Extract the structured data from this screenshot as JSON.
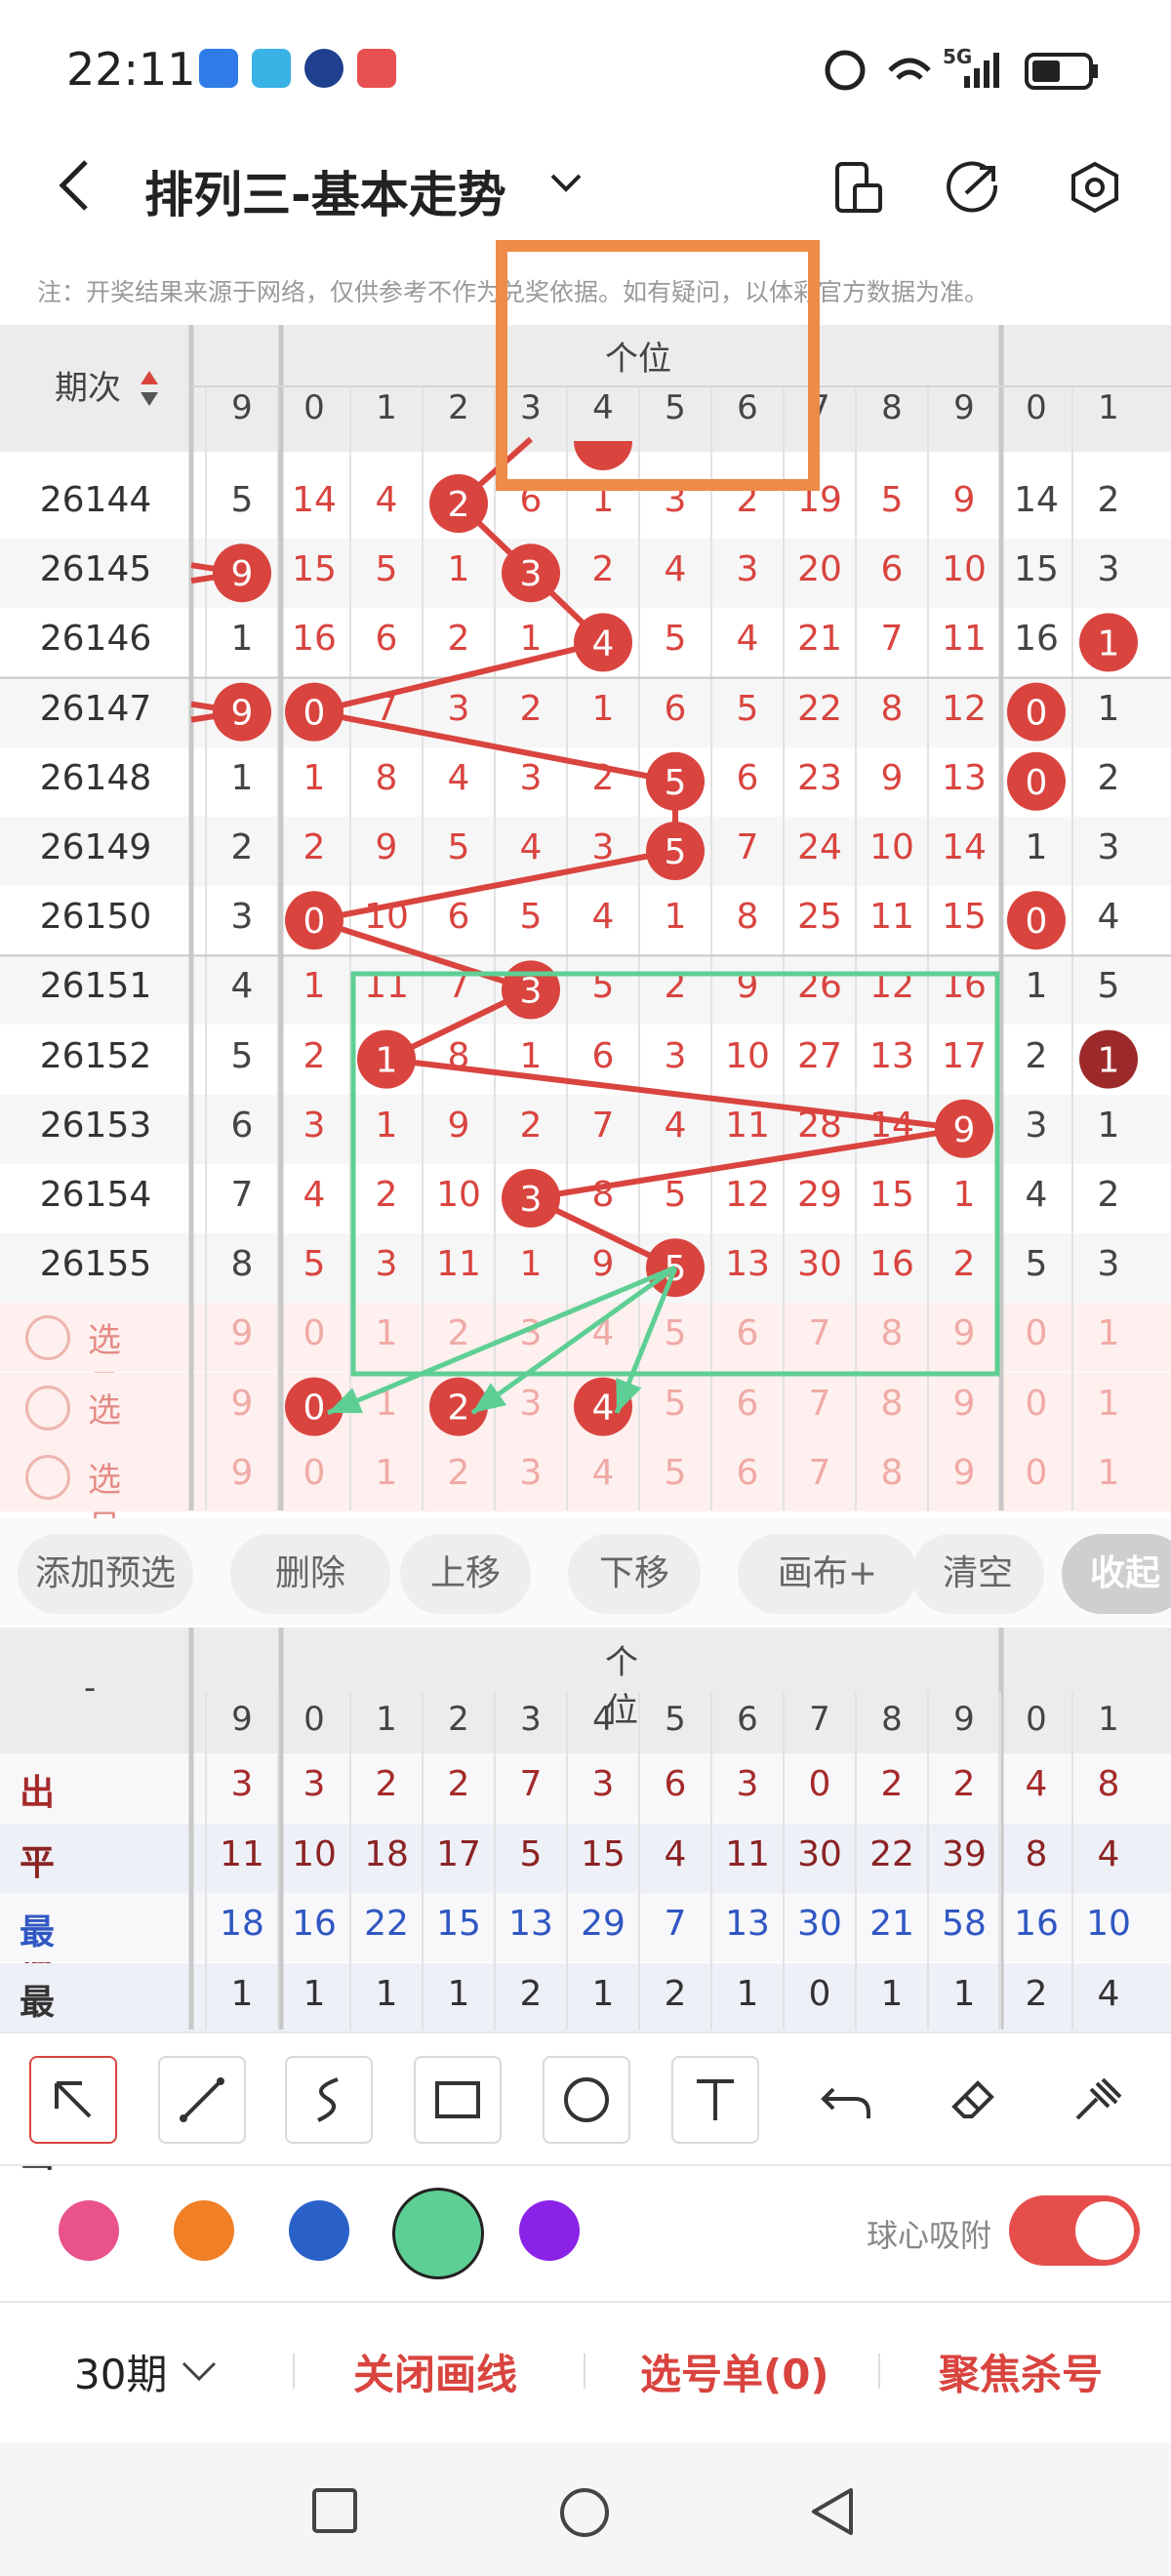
{
  "status": {
    "time": "22:11",
    "signal_label": "5G"
  },
  "header": {
    "title": "排列三-基本走势",
    "dropdown_icon": "chevron-down-icon",
    "icons": [
      "phone-icon",
      "share-icon",
      "settings-icon"
    ]
  },
  "notice": "注：开奖结果来源于网络，仅供参考不作为兑奖依据。如有疑问，以体彩官方数据为准。",
  "table": {
    "period_header": "期次",
    "group_label": "个位",
    "col_digits": [
      "9",
      "0",
      "1",
      "2",
      "3",
      "4",
      "5",
      "6",
      "7",
      "8",
      "9",
      "0",
      "1"
    ],
    "rows": [
      {
        "period": "26144",
        "cells": [
          "5",
          "14",
          "4",
          "2",
          "6",
          "1",
          "3",
          "2",
          "19",
          "5",
          "9",
          "14",
          "2"
        ]
      },
      {
        "period": "26145",
        "cells": [
          "9",
          "15",
          "5",
          "1",
          "3",
          "2",
          "4",
          "3",
          "20",
          "6",
          "10",
          "15",
          "3"
        ]
      },
      {
        "period": "26146",
        "cells": [
          "1",
          "16",
          "6",
          "2",
          "1",
          "4",
          "5",
          "4",
          "21",
          "7",
          "11",
          "16",
          "1"
        ]
      },
      {
        "period": "26147",
        "cells": [
          "9",
          "0",
          "7",
          "3",
          "2",
          "1",
          "6",
          "5",
          "22",
          "8",
          "12",
          "0",
          "1"
        ]
      },
      {
        "period": "26148",
        "cells": [
          "1",
          "1",
          "8",
          "4",
          "3",
          "2",
          "5",
          "6",
          "23",
          "9",
          "13",
          "0",
          "2"
        ]
      },
      {
        "period": "26149",
        "cells": [
          "2",
          "2",
          "9",
          "5",
          "4",
          "3",
          "5",
          "7",
          "24",
          "10",
          "14",
          "1",
          "3"
        ]
      },
      {
        "period": "26150",
        "cells": [
          "3",
          "0",
          "10",
          "6",
          "5",
          "4",
          "1",
          "8",
          "25",
          "11",
          "15",
          "0",
          "4"
        ]
      },
      {
        "period": "26151",
        "cells": [
          "4",
          "1",
          "11",
          "7",
          "3",
          "5",
          "2",
          "9",
          "26",
          "12",
          "16",
          "1",
          "5"
        ]
      },
      {
        "period": "26152",
        "cells": [
          "5",
          "2",
          "1",
          "8",
          "1",
          "6",
          "3",
          "10",
          "27",
          "13",
          "17",
          "2",
          "1"
        ]
      },
      {
        "period": "26153",
        "cells": [
          "6",
          "3",
          "1",
          "9",
          "2",
          "7",
          "4",
          "11",
          "28",
          "14",
          "9",
          "3",
          "1"
        ]
      },
      {
        "period": "26154",
        "cells": [
          "7",
          "4",
          "2",
          "10",
          "3",
          "8",
          "5",
          "12",
          "29",
          "15",
          "1",
          "4",
          "2"
        ]
      },
      {
        "period": "26155",
        "cells": [
          "8",
          "5",
          "3",
          "11",
          "1",
          "9",
          "5",
          "13",
          "30",
          "16",
          "2",
          "5",
          "3"
        ]
      }
    ],
    "select_label": "选号",
    "select_digits": [
      "9",
      "0",
      "1",
      "2",
      "3",
      "4",
      "5",
      "6",
      "7",
      "8",
      "9",
      "0",
      "1"
    ]
  },
  "toolbar_buttons": [
    "添加预选",
    "删除",
    "上移",
    "下移",
    "画布+",
    "清空",
    "收起"
  ],
  "stats": {
    "dash": "-",
    "group_label": "个位",
    "col_digits": [
      "9",
      "0",
      "1",
      "2",
      "3",
      "4",
      "5",
      "6",
      "7",
      "8",
      "9",
      "0",
      "1"
    ],
    "rows": [
      {
        "label": "出现次数",
        "values": [
          "3",
          "3",
          "2",
          "2",
          "7",
          "3",
          "6",
          "3",
          "0",
          "2",
          "2",
          "4",
          "8"
        ],
        "color": "#a52a2a"
      },
      {
        "label": "平均遗漏",
        "values": [
          "11",
          "10",
          "18",
          "17",
          "5",
          "15",
          "4",
          "11",
          "30",
          "22",
          "39",
          "8",
          "4"
        ],
        "color": "#8b2323"
      },
      {
        "label": "最大遗漏",
        "values": [
          "18",
          "16",
          "22",
          "15",
          "13",
          "29",
          "7",
          "13",
          "30",
          "21",
          "58",
          "16",
          "10"
        ],
        "color": "#3057c2"
      },
      {
        "label": "最大连出",
        "values": [
          "1",
          "1",
          "1",
          "1",
          "2",
          "1",
          "2",
          "1",
          "0",
          "1",
          "1",
          "2",
          "4"
        ],
        "color": "#333333"
      }
    ]
  },
  "draw_tools": [
    "arrow-icon",
    "line-icon",
    "curve-icon",
    "rectangle-icon",
    "circle-icon",
    "text-icon",
    "undo-icon",
    "eraser-icon",
    "brush-icon"
  ],
  "colors": [
    "#e9528a",
    "#f07f26",
    "#2961c9",
    "#5ecf94",
    "#8b22e8"
  ],
  "snap_label": "球心吸附",
  "snap_on": true,
  "bottom_bar": {
    "periods": "30期",
    "close_lines": "关闭画线",
    "selection": "选号单(0)",
    "focus": "聚焦杀号"
  },
  "accent": "#d9443f"
}
